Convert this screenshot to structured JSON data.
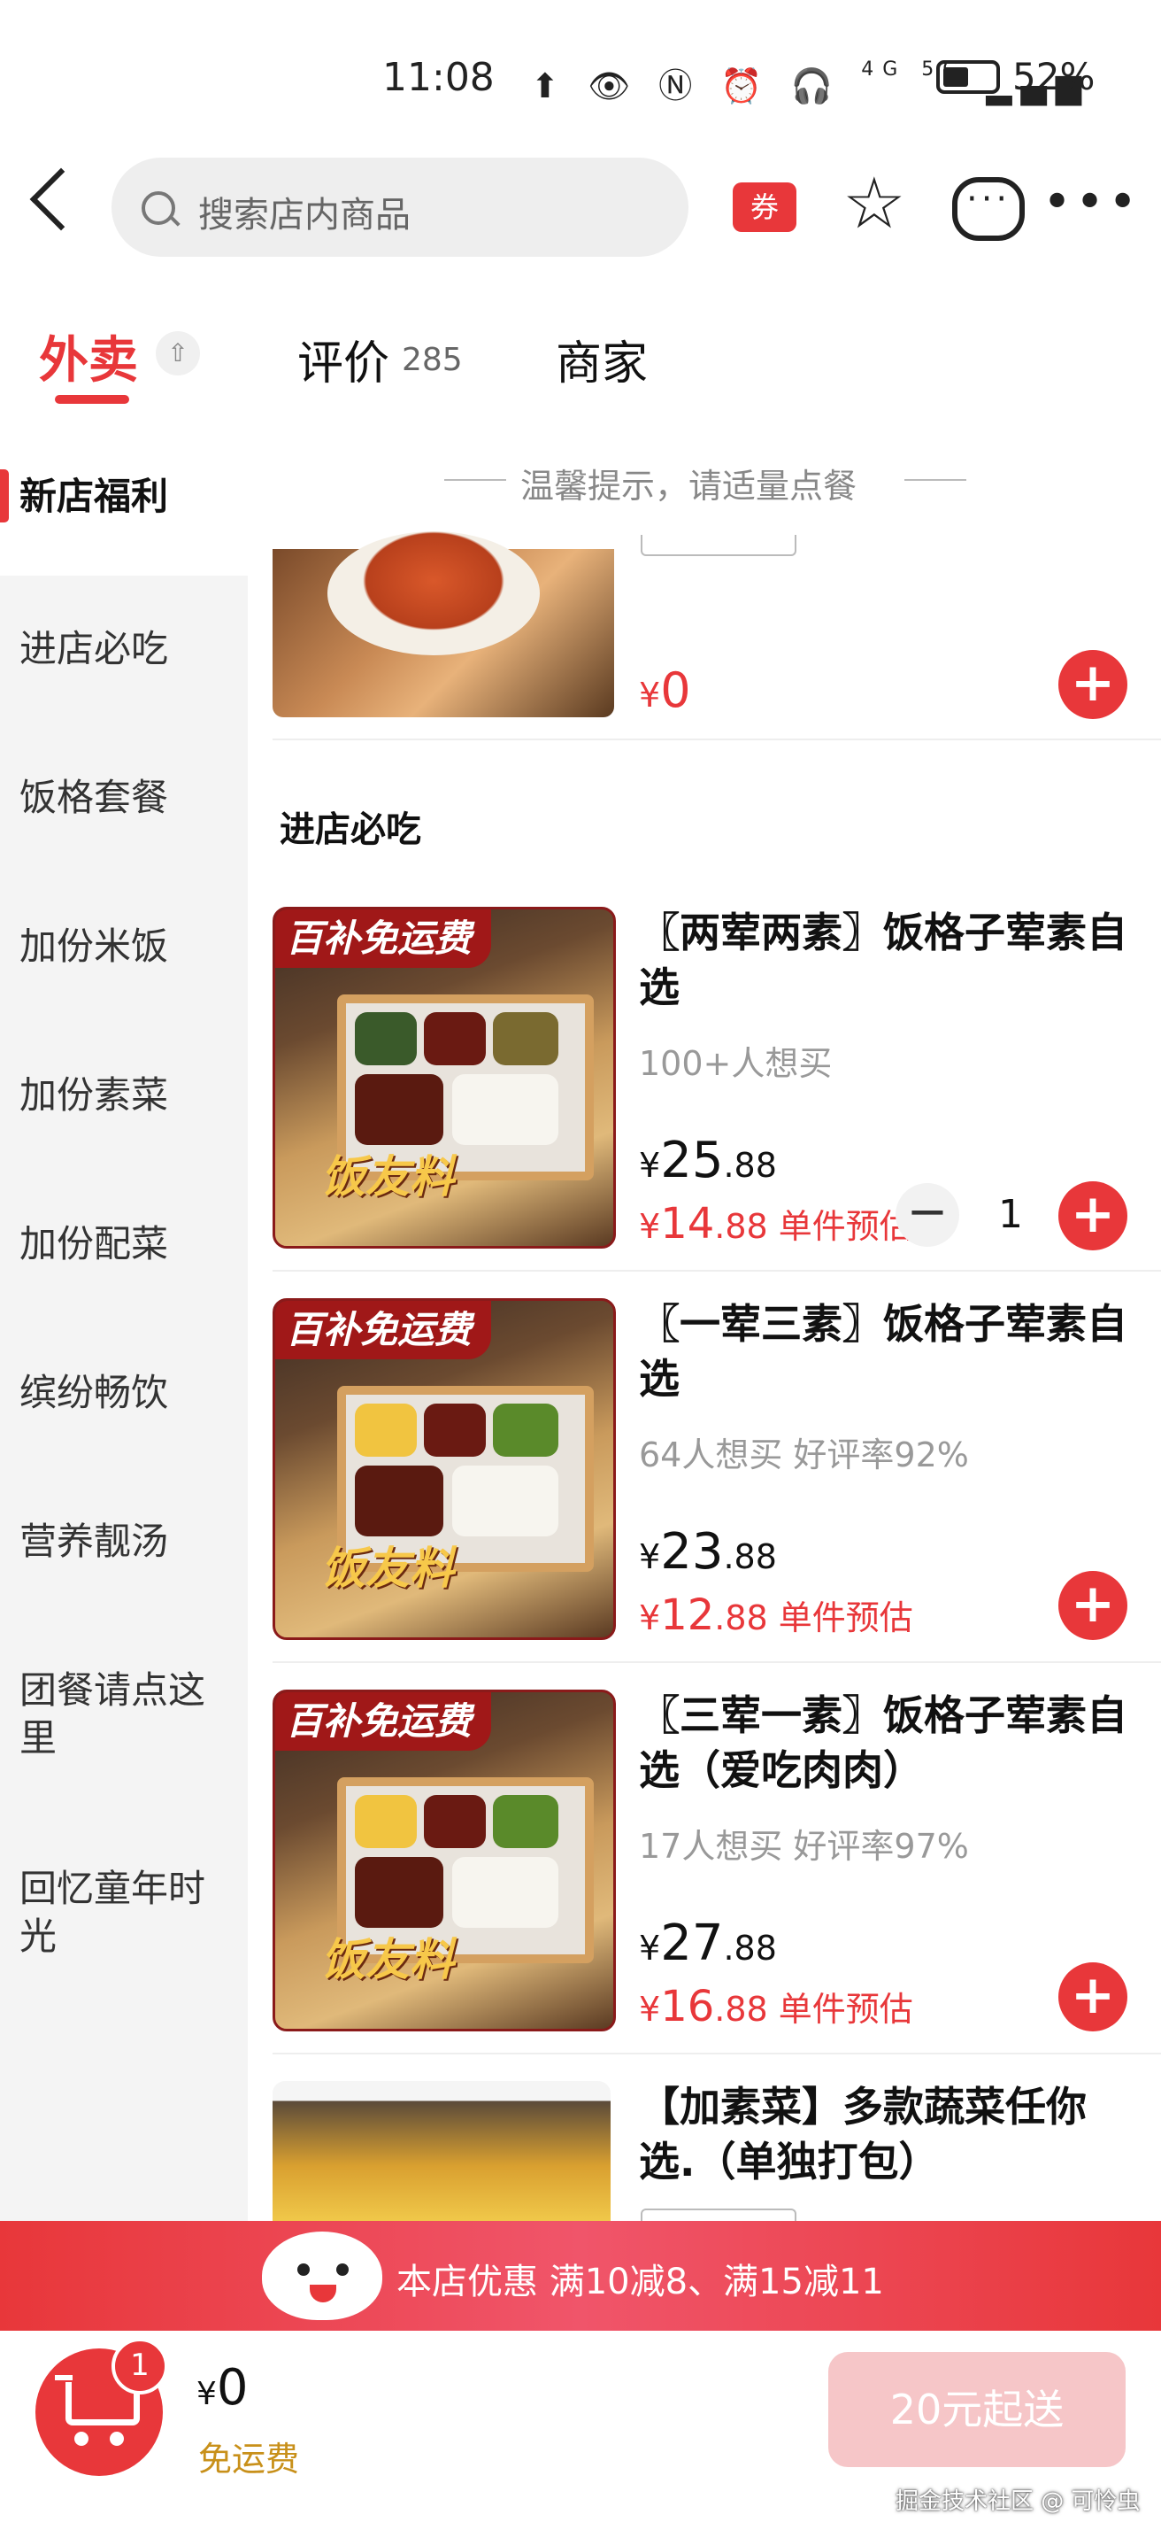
{
  "status_bar": {
    "time": "11:08",
    "network": "4G 5G",
    "battery": "52%",
    "icons": [
      "upload-icon",
      "eye-icon",
      "nfc-icon",
      "alarm-icon",
      "headphones-icon",
      "signal-icon",
      "battery-icon"
    ]
  },
  "header": {
    "search_placeholder": "搜索店内商品",
    "coupon_label": "券"
  },
  "tabs": {
    "waimai": "外卖",
    "pingjia": "评价",
    "pingjia_count": "285",
    "shangjia": "商家",
    "collapse_glyph": "⇧"
  },
  "sidebar": {
    "items": [
      "新店福利",
      "进店必吃",
      "饭格套餐",
      "加份米饭",
      "加份素菜",
      "加份配菜",
      "缤纷畅饮",
      "营养靓汤",
      "团餐请点这里",
      "回忆童年时光"
    ],
    "active_index": 0
  },
  "content": {
    "tip": "温馨提示，请适量点餐",
    "prev_item_price_symbol": "¥",
    "prev_item_price": "0",
    "section_title": "进店必吃",
    "products": [
      {
        "badge": "百补免运费",
        "slogan": "饭友料",
        "title": "〖两荤两素〗饭格子荤素自选",
        "meta": "100+人想买",
        "price_symbol": "¥",
        "orig_int": "25",
        "orig_dec": ".88",
        "deal_int": "14",
        "deal_dec": ".88",
        "deal_suffix": " 单件预估",
        "quantity": "1"
      },
      {
        "badge": "百补免运费",
        "slogan": "饭友料",
        "title": "〖一荤三素〗饭格子荤素自选",
        "meta": "64人想买  好评率92%",
        "price_symbol": "¥",
        "orig_int": "23",
        "orig_dec": ".88",
        "deal_int": "12",
        "deal_dec": ".88",
        "deal_suffix": " 单件预估"
      },
      {
        "badge": "百补免运费",
        "slogan": "饭友料",
        "title": "〖三荤一素〗饭格子荤素自选（爱吃肉肉）",
        "meta": "17人想买  好评率97%",
        "price_symbol": "¥",
        "orig_int": "27",
        "orig_dec": ".88",
        "deal_int": "16",
        "deal_dec": ".88",
        "deal_suffix": " 单件预估"
      },
      {
        "title": "【加素菜】多款蔬菜任你选.（单独打包）"
      }
    ]
  },
  "promo": {
    "text": "本店优惠  满10减8、满15减11"
  },
  "bottom_bar": {
    "cart_count": "1",
    "total_symbol": "¥",
    "total": "0",
    "shipping": "免运费",
    "submit": "20元起送"
  },
  "watermark": "掘金技术社区 @ 可怜虫",
  "colors": {
    "accent": "#e8373a",
    "submit_disabled": "#f6c6c8",
    "shipping": "#c8901a"
  }
}
